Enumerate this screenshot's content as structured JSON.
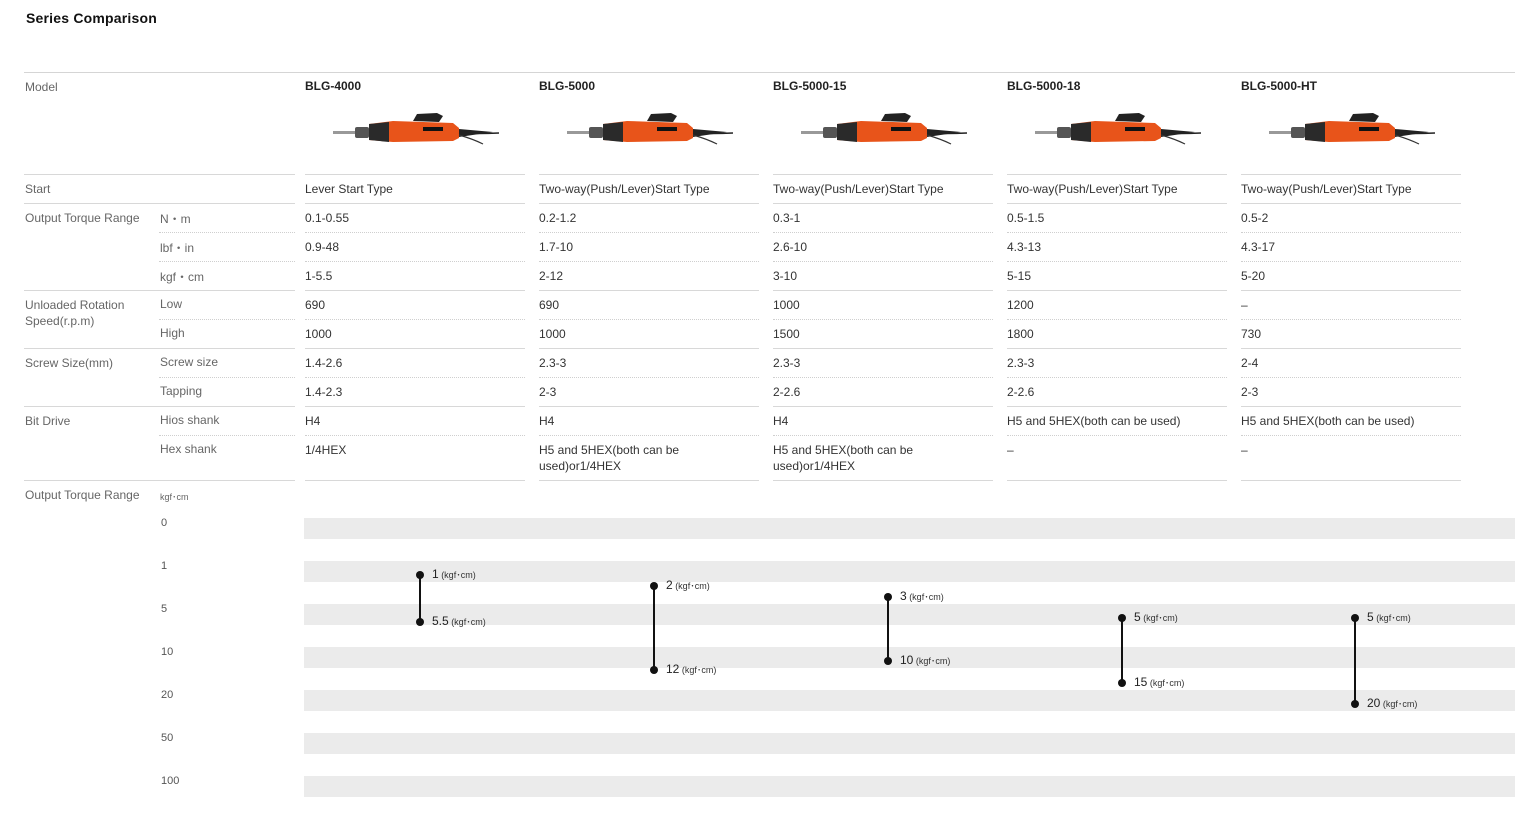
{
  "title": "Series Comparison",
  "labels": {
    "model": "Model",
    "start": "Start",
    "output_torque_range": "Output Torque Range",
    "unloaded_rotation_speed": "Unloaded Rotation Speed(r.p.m)",
    "screw_size": "Screw Size(mm)",
    "bit_drive": "Bit Drive",
    "output_torque_chart": "Output Torque Range"
  },
  "sublabels": {
    "nm": "N・m",
    "lbfin": "lbf・in",
    "kgfcm": "kgf・cm",
    "low": "Low",
    "high": "High",
    "screw_size": "Screw size",
    "tapping": "Tapping",
    "hios_shank": "Hios shank",
    "hex_shank": "Hex shank",
    "chart_unit": "kgf･cm"
  },
  "models": [
    {
      "name": "BLG-4000",
      "start": "Lever Start Type",
      "nm": "0.1-0.55",
      "lbfin": "0.9-48",
      "kgfcm": "1-5.5",
      "low": "690",
      "high": "1000",
      "screw": "1.4-2.6",
      "tapping": "1.4-2.3",
      "hios": "H4",
      "hex": "1/4HEX",
      "tool_color": "#e8541a",
      "chart_low": "1",
      "chart_high": "5.5"
    },
    {
      "name": "BLG-5000",
      "start": "Two-way(Push/Lever)Start Type",
      "nm": "0.2-1.2",
      "lbfin": "1.7-10",
      "kgfcm": "2-12",
      "low": "690",
      "high": "1000",
      "screw": "2.3-3",
      "tapping": "2-3",
      "hios": "H4",
      "hex": "H5 and 5HEX(both can be used)or1/4HEX",
      "tool_color": "#e8541a",
      "chart_low": "2",
      "chart_high": "12"
    },
    {
      "name": "BLG-5000-15",
      "start": "Two-way(Push/Lever)Start Type",
      "nm": "0.3-1",
      "lbfin": "2.6-10",
      "kgfcm": "3-10",
      "low": "1000",
      "high": "1500",
      "screw": "2.3-3",
      "tapping": "2-2.6",
      "hios": "H4",
      "hex": "H5 and 5HEX(both can be used)or1/4HEX",
      "tool_color": "#e8541a",
      "chart_low": "3",
      "chart_high": "10"
    },
    {
      "name": "BLG-5000-18",
      "start": "Two-way(Push/Lever)Start Type",
      "nm": "0.5-1.5",
      "lbfin": "4.3-13",
      "kgfcm": "5-15",
      "low": "1200",
      "high": "1800",
      "screw": "2.3-3",
      "tapping": "2-2.6",
      "hios": "H5 and 5HEX(both can be used)",
      "hex": "–",
      "tool_color": "#e8541a",
      "chart_low": "5",
      "chart_high": "15"
    },
    {
      "name": "BLG-5000-HT",
      "start": "Two-way(Push/Lever)Start Type",
      "nm": "0.5-2",
      "lbfin": "4.3-17",
      "kgfcm": "5-20",
      "low": "–",
      "high": "730",
      "screw": "2-4",
      "tapping": "2-3",
      "hios": "H5 and 5HEX(both can be used)",
      "hex": "–",
      "tool_color": "#e8541a",
      "chart_low": "5",
      "chart_high": "20"
    }
  ],
  "chart_data": {
    "type": "range",
    "unit": "(kgf･cm)",
    "ticks": [
      "0",
      "1",
      "5",
      "10",
      "20",
      "50",
      "100"
    ],
    "series": [
      {
        "name": "BLG-4000",
        "low": 1,
        "high": 5.5
      },
      {
        "name": "BLG-5000",
        "low": 2,
        "high": 12
      },
      {
        "name": "BLG-5000-15",
        "low": 3,
        "high": 10
      },
      {
        "name": "BLG-5000-18",
        "low": 5,
        "high": 15
      },
      {
        "name": "BLG-5000-HT",
        "low": 5,
        "high": 20
      }
    ]
  }
}
